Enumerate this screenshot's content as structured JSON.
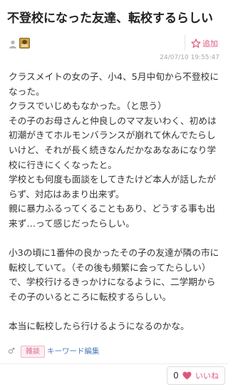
{
  "post": {
    "title": "不登校になった友達、転校するらしい",
    "timestamp": "24/07/10 19:55:47",
    "add_label": "追加",
    "body": "クラスメイトの女の子、小4、5月中旬から不登校になった。\nクラスでいじめもなかった。（と思う）\nその子のお母さんと仲良しのママ友いわく、初めは初潮がきてホルモンバランスが崩れて休んでたらしいけど、それが長く続きなんだかなあなあになり学校に行きにくくなったと。\n学校とも何度も面談をしてきたけど本人が話したがらず、対応はあまり出来ず。\n親に暴力ふるってくることもあり、どうする事も出来ず…って感じだったらしい。\n\n小3の頃に1番仲の良かったその子の友達が隣の市に転校していて。（その後も頻繁に会ってたらしい）\nで、学校行けるきっかけになるように、二学期からその子のいるところに転校するらしい。\n\n本当に転校したら行けるようになるのかな。",
    "gender_symbol": "♂",
    "tag": "雑談",
    "keyword_edit": "キーワード編集",
    "like_count": "0",
    "like_label": "いいね"
  },
  "colors": {
    "accent_pink": "#e0567d",
    "link_blue": "#4a78b8",
    "text": "#333333",
    "muted": "#aaaaaa"
  },
  "icons": {
    "user": "user-icon",
    "avatar": "avatar-image",
    "add": "star-plus-icon",
    "gender": "male-icon",
    "like": "heart-icon"
  }
}
